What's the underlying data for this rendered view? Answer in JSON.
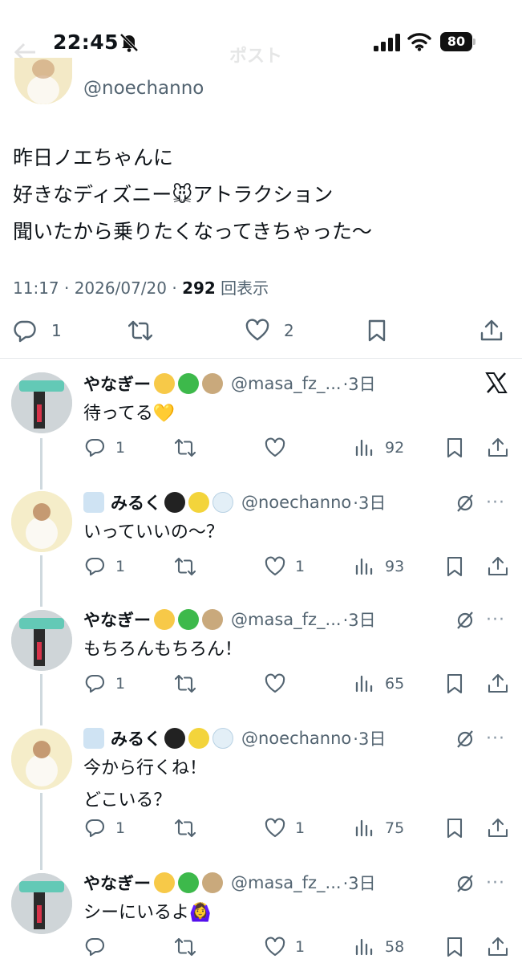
{
  "status_bar": {
    "time": "22:45",
    "battery": "80"
  },
  "header": {
    "title": "ポスト"
  },
  "main_tweet": {
    "handle": "@noechanno",
    "text_lines": [
      "昨日ノエちゃんに",
      "好きなディズニー🐭アトラクション",
      "聞いたから乗りたくなってきちゃった〜"
    ],
    "time": "11:17 · 2026/07/20 · ",
    "views_count": "292",
    "views_label": " 回表示",
    "replies": "1",
    "likes": "2"
  },
  "replies": [
    {
      "name": "やなぎー",
      "handle": "@masa_fz_...",
      "age": "·3日",
      "text": [
        "待ってる💛"
      ],
      "replies": "1",
      "likes": "",
      "views": "92"
    },
    {
      "name": "みるく",
      "handle": "@noechanno",
      "age": "·3日",
      "text": [
        "いっていいの〜？"
      ],
      "replies": "1",
      "likes": "1",
      "views": "93"
    },
    {
      "name": "やなぎー",
      "handle": "@masa_fz_...",
      "age": "·3日",
      "text": [
        "もちろんもちろん！"
      ],
      "replies": "1",
      "likes": "",
      "views": "65"
    },
    {
      "name": "みるく",
      "handle": "@noechanno",
      "age": "·3日",
      "text": [
        "今から行くね！",
        "どこいる？"
      ],
      "replies": "1",
      "likes": "1",
      "views": "75"
    },
    {
      "name": "やなぎー",
      "handle": "@masa_fz_...",
      "age": "·3日",
      "text": [
        "シーにいるよ🙆‍♀️"
      ],
      "replies": "",
      "likes": "1",
      "views": "58"
    }
  ],
  "icons": {
    "more": "···"
  },
  "colors": {
    "text": "#0f1419",
    "secondary": "#536471",
    "divider": "#e6e9ec",
    "thread": "#cfd9de"
  }
}
